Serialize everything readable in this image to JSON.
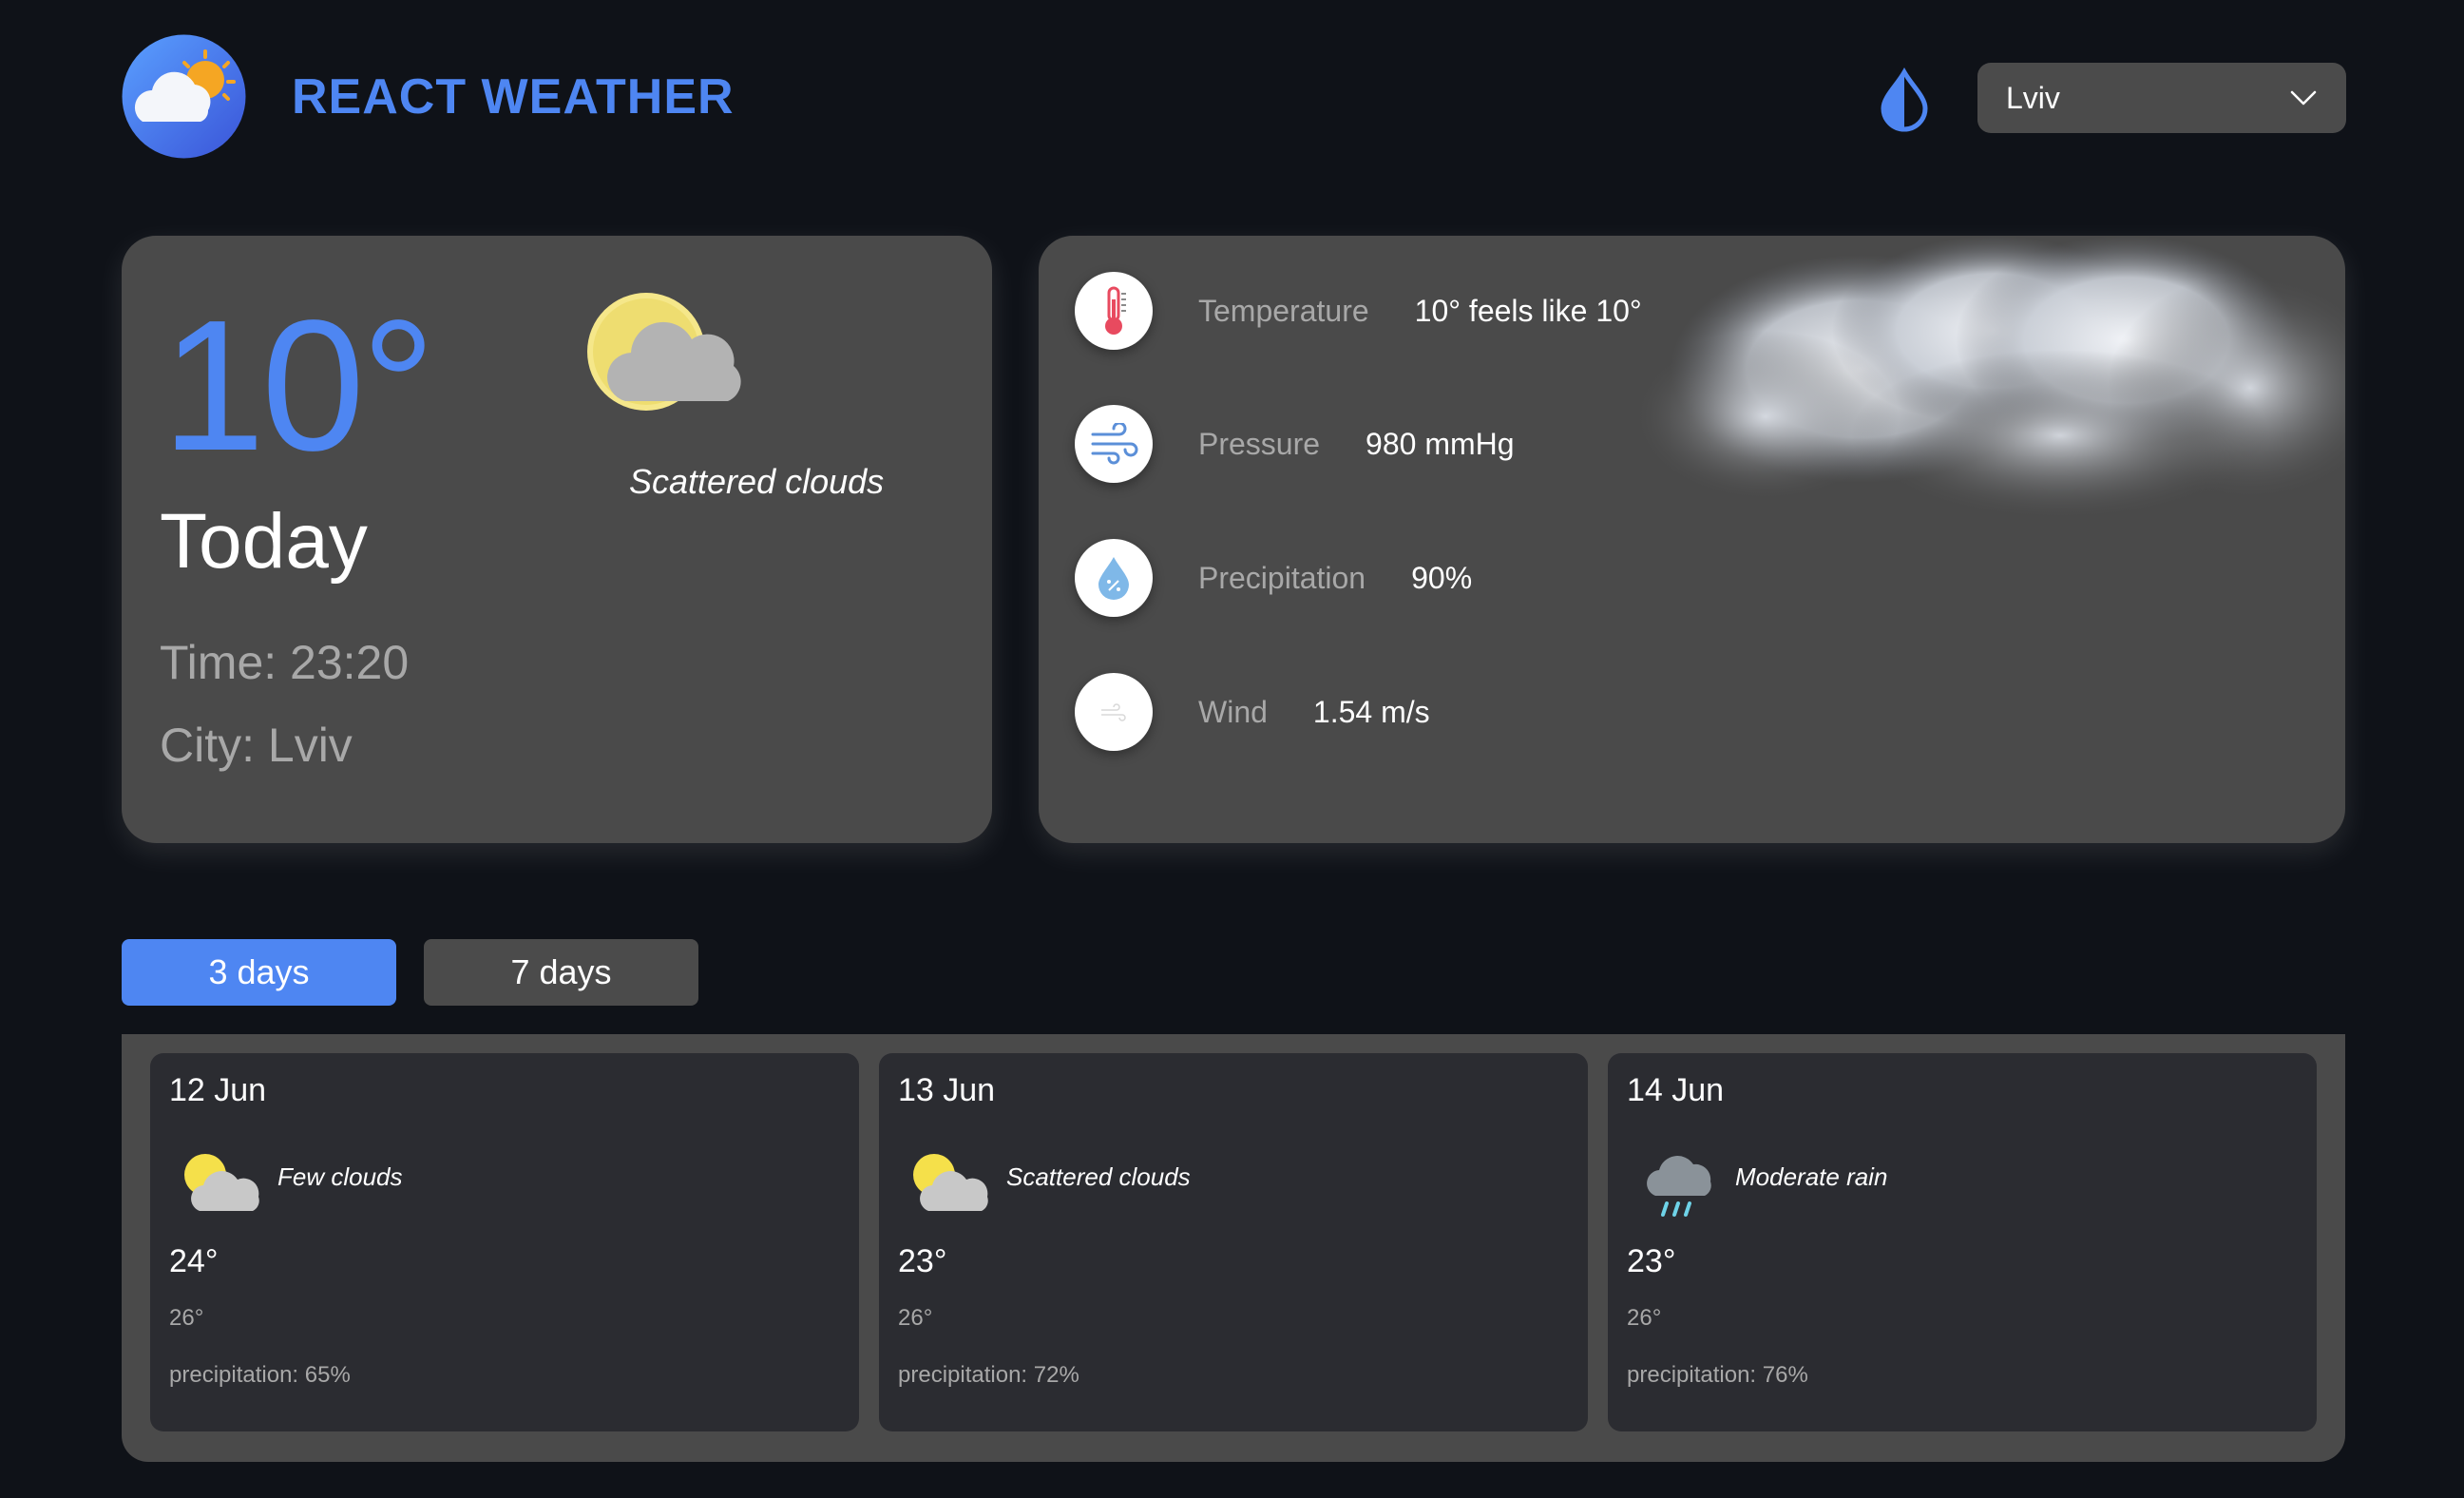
{
  "header": {
    "title": "REACT WEATHER",
    "city_select_value": "Lviv"
  },
  "today": {
    "temperature": "10°",
    "label": "Today",
    "time": "Time: 23:20",
    "city": "City: Lviv",
    "description": "Scattered clouds"
  },
  "details": [
    {
      "label": "Temperature",
      "value": "10° feels like 10°",
      "icon": "thermometer-icon"
    },
    {
      "label": "Pressure",
      "value": "980 mmHg",
      "icon": "wind-pressure-icon"
    },
    {
      "label": "Precipitation",
      "value": "90%",
      "icon": "water-drop-icon"
    },
    {
      "label": "Wind",
      "value": "1.54 m/s",
      "icon": "wind-icon"
    }
  ],
  "tabs": [
    {
      "label": "3 days",
      "active": true
    },
    {
      "label": "7 days",
      "active": false
    }
  ],
  "forecast": [
    {
      "date": "12 Jun",
      "description": "Few clouds",
      "temp": "24°",
      "max": "26°",
      "precipitation": "precipitation: 65%",
      "icon": "partly-cloudy-icon"
    },
    {
      "date": "13 Jun",
      "description": "Scattered clouds",
      "temp": "23°",
      "max": "26°",
      "precipitation": "precipitation: 72%",
      "icon": "partly-cloudy-icon"
    },
    {
      "date": "14 Jun",
      "description": "Moderate rain",
      "temp": "23°",
      "max": "26°",
      "precipitation": "precipitation: 76%",
      "icon": "rain-cloud-icon"
    }
  ],
  "colors": {
    "accent": "#4e86f2",
    "background": "#0f1218",
    "card": "#4a4a4a",
    "day_card": "#2b2c31"
  }
}
